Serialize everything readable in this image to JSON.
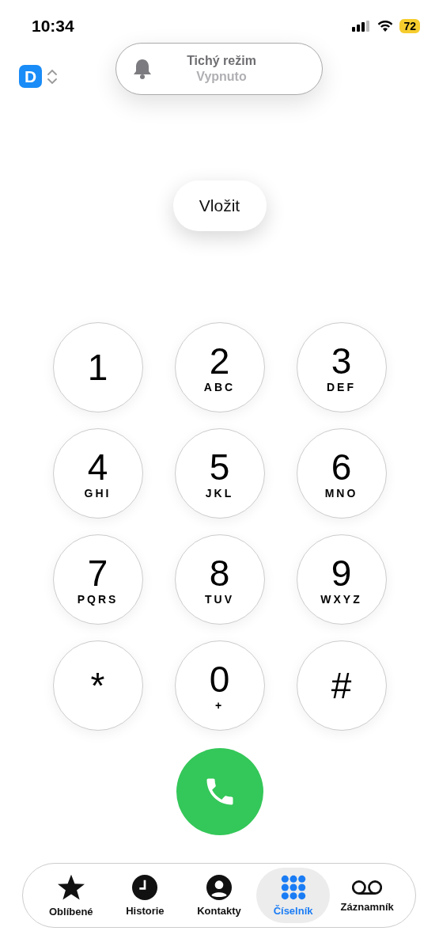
{
  "status_bar": {
    "time": "10:34",
    "battery": "72"
  },
  "app_badge": {
    "letter": "D"
  },
  "toast": {
    "title": "Tichý režim",
    "subtitle": "Vypnuto"
  },
  "paste_button": {
    "label": "Vložit"
  },
  "keypad": [
    {
      "digit": "1"
    },
    {
      "digit": "2",
      "letters": "ABC"
    },
    {
      "digit": "3",
      "letters": "DEF"
    },
    {
      "digit": "4",
      "letters": "GHI"
    },
    {
      "digit": "5",
      "letters": "JKL"
    },
    {
      "digit": "6",
      "letters": "MNO"
    },
    {
      "digit": "7",
      "letters": "PQRS"
    },
    {
      "digit": "8",
      "letters": "TUV"
    },
    {
      "digit": "9",
      "letters": "WXYZ"
    },
    {
      "digit": "*"
    },
    {
      "digit": "0",
      "letters": "+"
    },
    {
      "digit": "#"
    }
  ],
  "tabs": [
    {
      "label": "Oblíbené",
      "kind": "star",
      "selected": false
    },
    {
      "label": "Historie",
      "kind": "clock",
      "selected": false
    },
    {
      "label": "Kontakty",
      "kind": "person",
      "selected": false
    },
    {
      "label": "Číselník",
      "kind": "keypad",
      "selected": true
    },
    {
      "label": "Záznamník",
      "kind": "voicemail",
      "selected": false
    }
  ]
}
